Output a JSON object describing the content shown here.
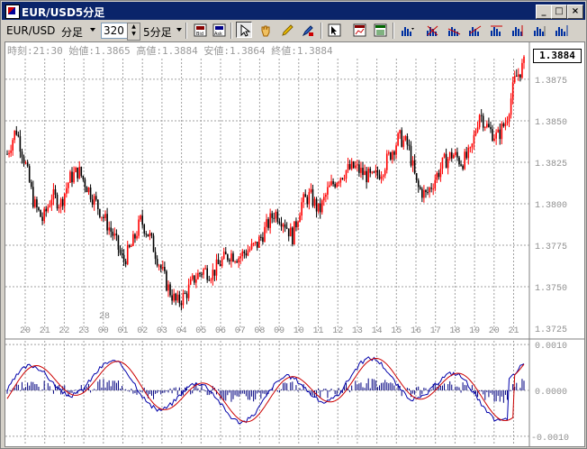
{
  "window": {
    "title": "EUR/USD5分足"
  },
  "toolbar": {
    "symbol": "EUR/USD",
    "bar_type": "分足",
    "bar_count": "320",
    "interval": "5分足"
  },
  "chart_info": {
    "info_line": "時刻:21:30 始値:1.3865 高値:1.3884 安値:1.3864 終値:1.3884",
    "current_price": "1.3884"
  },
  "chart_data": [
    {
      "type": "candlestick",
      "symbol": "EUR/USD",
      "x_tick_labels": [
        "20",
        "21",
        "22",
        "23",
        "00",
        "01",
        "02",
        "03",
        "04",
        "05",
        "06",
        "07",
        "08",
        "09",
        "10",
        "11",
        "12",
        "13",
        "14",
        "15",
        "16",
        "17",
        "18",
        "19",
        "20",
        "21"
      ],
      "date_label": "28",
      "y_tick_labels": [
        "1.3750",
        "1.3775",
        "1.3800",
        "1.3825",
        "1.3850",
        "1.3875"
      ],
      "y_extra_label": "1.3725",
      "ylim": [
        1.3725,
        1.3888
      ],
      "up_color": "#ff0000",
      "down_color": "#000000",
      "grid": true,
      "close_approx": [
        [
          0,
          1.383
        ],
        [
          1,
          1.3845
        ],
        [
          2,
          1.3825
        ],
        [
          3,
          1.38
        ],
        [
          4,
          1.379
        ],
        [
          5,
          1.3805
        ],
        [
          6,
          1.38
        ],
        [
          7,
          1.3815
        ],
        [
          8,
          1.382
        ],
        [
          9,
          1.381
        ],
        [
          10,
          1.38
        ],
        [
          11,
          1.379
        ],
        [
          12,
          1.378
        ],
        [
          13,
          1.3765
        ],
        [
          14,
          1.3775
        ],
        [
          15,
          1.379
        ],
        [
          16,
          1.378
        ],
        [
          17,
          1.3765
        ],
        [
          18,
          1.375
        ],
        [
          19,
          1.374
        ],
        [
          20,
          1.3745
        ],
        [
          21,
          1.3755
        ],
        [
          22,
          1.376
        ],
        [
          23,
          1.3758
        ],
        [
          24,
          1.3765
        ],
        [
          25,
          1.377
        ],
        [
          26,
          1.3768
        ],
        [
          27,
          1.3772
        ],
        [
          28,
          1.3775
        ],
        [
          29,
          1.3785
        ],
        [
          30,
          1.3795
        ],
        [
          31,
          1.379
        ],
        [
          32,
          1.378
        ],
        [
          33,
          1.38
        ],
        [
          34,
          1.3805
        ],
        [
          35,
          1.3795
        ],
        [
          36,
          1.3808
        ],
        [
          37,
          1.3815
        ],
        [
          38,
          1.382
        ],
        [
          39,
          1.3822
        ],
        [
          40,
          1.3818
        ],
        [
          41,
          1.3815
        ],
        [
          42,
          1.382
        ],
        [
          43,
          1.383
        ],
        [
          44,
          1.384
        ],
        [
          45,
          1.3835
        ],
        [
          46,
          1.381
        ],
        [
          47,
          1.3805
        ],
        [
          48,
          1.3815
        ],
        [
          49,
          1.3825
        ],
        [
          50,
          1.383
        ],
        [
          51,
          1.3825
        ],
        [
          52,
          1.383
        ],
        [
          53,
          1.3855
        ],
        [
          54,
          1.3845
        ],
        [
          55,
          1.384
        ],
        [
          56,
          1.385
        ],
        [
          57,
          1.3875
        ],
        [
          58,
          1.3884
        ]
      ],
      "overlay_text": "1.3875"
    },
    {
      "type": "line",
      "name": "oscillator",
      "y_tick_labels": [
        "0.0010",
        "0.0000",
        "-0.0010"
      ],
      "ylim": [
        -0.0012,
        0.0011
      ],
      "series_colors": [
        "#0000aa",
        "#cc0000"
      ]
    }
  ]
}
